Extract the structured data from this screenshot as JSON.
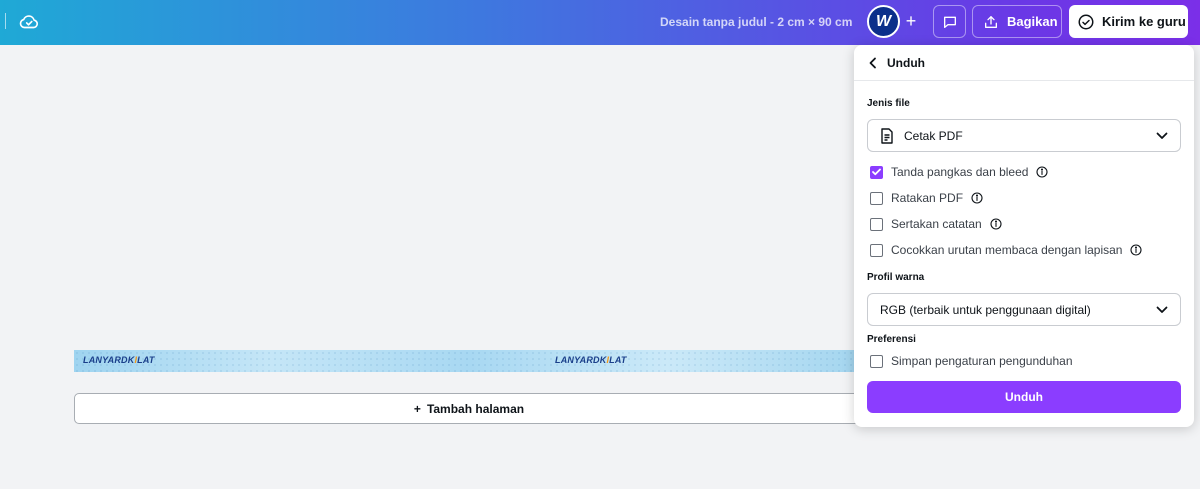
{
  "topbar": {
    "doc_title": "Desain tanpa judul - 2 cm × 90 cm",
    "avatar_letter": "W",
    "share_label": "Bagikan",
    "send_label": "Kirim ke guru"
  },
  "canvas": {
    "logo_left": "LANYARDK",
    "logo_left_accent": "I",
    "logo_left_end": "LAT",
    "logo_center": "LANYARDK",
    "logo_center_accent": "I",
    "logo_center_end": "LAT",
    "add_page_label": "Tambah halaman"
  },
  "download_panel": {
    "title": "Unduh",
    "file_type_label": "Jenis file",
    "file_type_value": "Cetak PDF",
    "options": [
      {
        "label": "Tanda pangkas dan bleed",
        "checked": true
      },
      {
        "label": "Ratakan PDF",
        "checked": false
      },
      {
        "label": "Sertakan catatan",
        "checked": false
      },
      {
        "label": "Cocokkan urutan membaca dengan lapisan",
        "checked": false
      }
    ],
    "color_profile_label": "Profil warna",
    "color_profile_value": "RGB (terbaik untuk penggunaan digital)",
    "preferences_label": "Preferensi",
    "save_settings_label": "Simpan pengaturan pengunduhan",
    "save_settings_checked": false,
    "download_button": "Unduh"
  },
  "colors": {
    "accent": "#8b3dff",
    "topbar_start": "#1fa9d6",
    "topbar_end": "#7b2fe8"
  }
}
